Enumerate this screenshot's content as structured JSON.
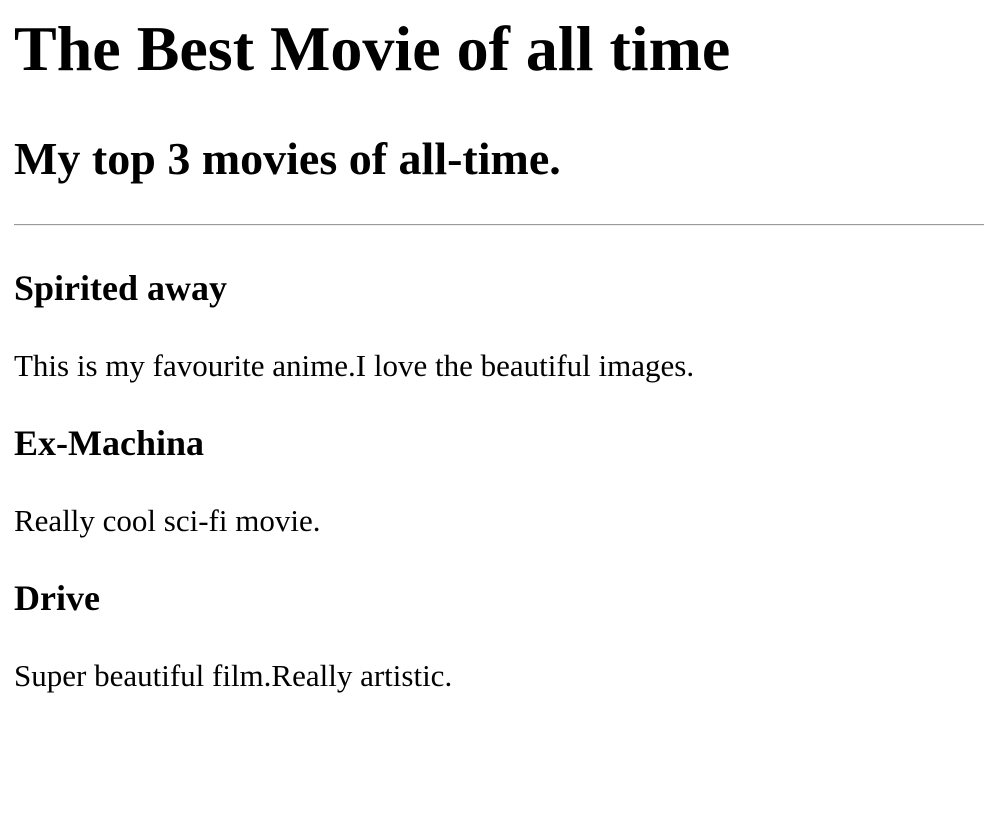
{
  "page": {
    "title": "The Best Movie of all time",
    "subtitle": "My top 3 movies of all-time."
  },
  "movies": [
    {
      "title": "Spirited away",
      "description": "This is my favourite anime.I love the beautiful images."
    },
    {
      "title": "Ex-Machina",
      "description": "Really cool sci-fi movie."
    },
    {
      "title": "Drive",
      "description": "Super beautiful film.Really artistic."
    }
  ]
}
